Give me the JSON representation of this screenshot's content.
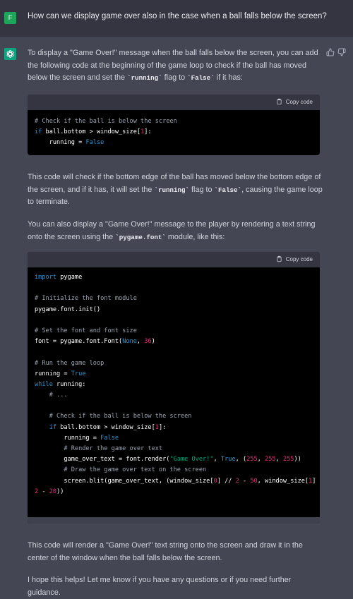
{
  "user": {
    "avatar_letter": "F",
    "question": "How can we display game over also in the case when a ball falls below the screen?"
  },
  "assistant": {
    "intro": {
      "part1": "To display a \"Game Over!\" message when the ball falls below the screen, you can add the following code at the beginning of the game loop to check if the ball has moved below the screen and set the ",
      "code1": "`running`",
      "part2": " flag to ",
      "code2": "`False`",
      "part3": " if it has:"
    },
    "copy_label": "Copy code",
    "code1": [
      "# Check if the ball is below the screen",
      "if ball.bottom > window_size[1]:",
      "    running = False"
    ],
    "explain": {
      "part1": "This code will check if the bottom edge of the ball has moved below the bottom edge of the screen, and if it has, it will set the ",
      "code1": "`running`",
      "part2": " flag to ",
      "code2": "`False`",
      "part3": ", causing the game loop to terminate."
    },
    "also": {
      "part1": "You can also display a \"Game Over!\" message to the player by rendering a text string onto the screen using the ",
      "code1": "`pygame.font`",
      "part2": " module, like this:"
    },
    "code2": [
      "import pygame",
      "",
      "# Initialize the font module",
      "pygame.font.init()",
      "",
      "# Set the font and font size",
      "font = pygame.font.Font(None, 36)",
      "",
      "# Run the game loop",
      "running = True",
      "while running:",
      "    # ...",
      "",
      "    # Check if the ball is below the screen",
      "    if ball.bottom > window_size[1]:",
      "        running = False",
      "        # Render the game over text",
      "        game_over_text = font.render(\"Game Over!\", True, (255, 255, 255))",
      "        # Draw the game over text on the screen",
      "        screen.blit(game_over_text, (window_size[0] // 2 - 50, window_size[1] //",
      "2 - 20))"
    ],
    "outro1": "This code will render a \"Game Over!\" text string onto the screen and draw it in the center of the window when the ball falls below the screen.",
    "outro2": "I hope this helps! Let me know if you have any questions or if you need further guidance."
  },
  "colors": {
    "user_bg": "#343541",
    "assistant_bg": "#444654",
    "user_avatar": "#1fa55a",
    "assistant_avatar": "#10a37f",
    "code_bg": "#000000"
  },
  "icons": [
    "chatgpt-logo-icon",
    "thumbs-up-icon",
    "thumbs-down-icon",
    "clipboard-icon"
  ]
}
